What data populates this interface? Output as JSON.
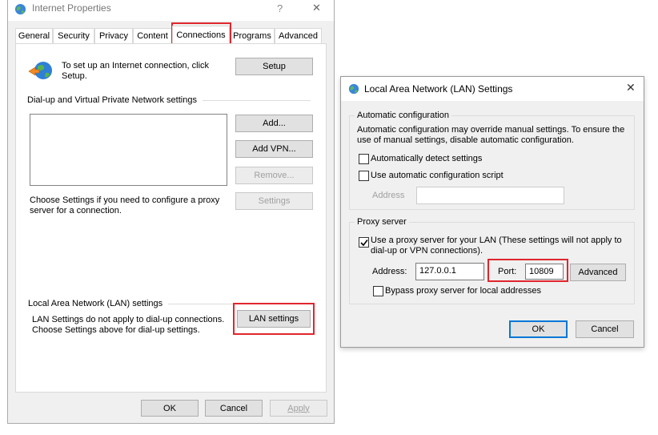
{
  "internet_properties": {
    "title": "Internet Properties",
    "help_glyph": "?",
    "close_glyph": "✕",
    "tabs": [
      {
        "label": "General"
      },
      {
        "label": "Security"
      },
      {
        "label": "Privacy"
      },
      {
        "label": "Content"
      },
      {
        "label": "Connections"
      },
      {
        "label": "Programs"
      },
      {
        "label": "Advanced"
      }
    ],
    "active_tab": "Connections",
    "setup_text": "To set up an Internet connection, click Setup.",
    "setup_button": "Setup",
    "dialup_group_label": "Dial-up and Virtual Private Network settings",
    "add_button": "Add...",
    "add_vpn_button": "Add VPN...",
    "remove_button": "Remove...",
    "settings_button": "Settings",
    "proxy_hint": "Choose Settings if you need to configure a proxy server for a connection.",
    "lan_group_label": "Local Area Network (LAN) settings",
    "lan_text": "LAN Settings do not apply to dial-up connections. Choose Settings above for dial-up settings.",
    "lan_settings_button": "LAN settings",
    "ok_button": "OK",
    "cancel_button": "Cancel",
    "apply_button": "Apply"
  },
  "lan_dialog": {
    "title": "Local Area Network (LAN) Settings",
    "close_glyph": "✕",
    "auto_config_label": "Automatic configuration",
    "auto_config_desc": "Automatic configuration may override manual settings.  To ensure the use of manual settings, disable automatic configuration.",
    "auto_detect_label": "Automatically detect settings",
    "auto_detect_checked": false,
    "auto_script_label": "Use automatic configuration script",
    "auto_script_checked": false,
    "script_address_label": "Address",
    "script_address_value": "",
    "proxy_group_label": "Proxy server",
    "use_proxy_label": "Use a proxy server for your LAN (These settings will not apply to dial-up or VPN connections).",
    "use_proxy_checked": true,
    "address_label": "Address:",
    "address_value": "127.0.0.1",
    "port_label": "Port:",
    "port_value": "10809",
    "advanced_button": "Advanced",
    "bypass_label": "Bypass proxy server for local addresses",
    "bypass_checked": false,
    "ok_button": "OK",
    "cancel_button": "Cancel"
  },
  "colors": {
    "highlight": "#e0262e",
    "accent": "#0078d7",
    "button_face": "#e1e1e1"
  }
}
